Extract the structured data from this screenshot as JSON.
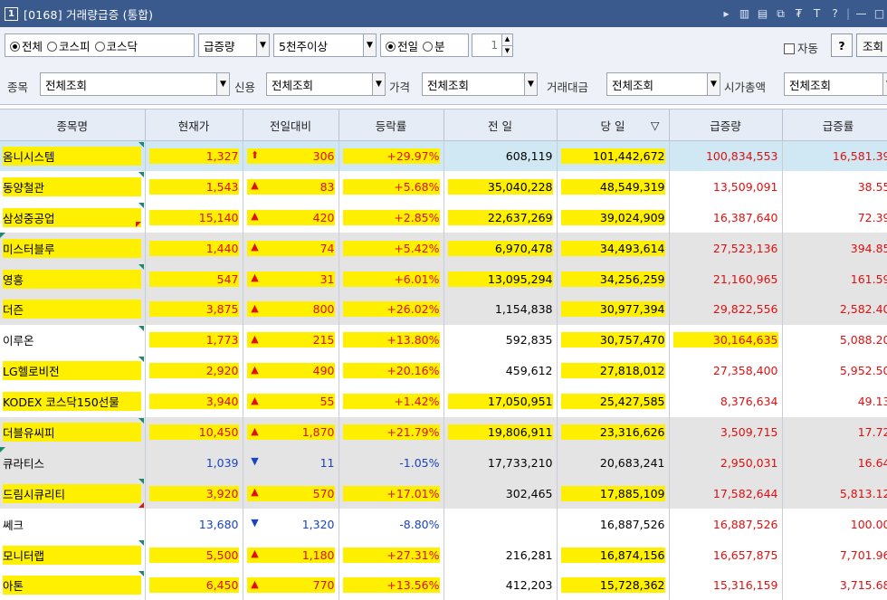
{
  "window": {
    "number": "1",
    "title": "[0168] 거래량급증 (통합)",
    "tools": [
      "▸",
      "▥",
      "▤",
      "⧉",
      "₮",
      "T",
      "?",
      "|",
      "—",
      "□"
    ]
  },
  "toolbar1": {
    "market_options": [
      "전체",
      "코스피",
      "코스닥"
    ],
    "market_selected": "전체",
    "sort_combo": "급증량",
    "volume_combo": "5천주이상",
    "period_options": [
      "전일",
      "분"
    ],
    "period_selected": "전일",
    "minute_value": "1",
    "auto_label": "자동",
    "help_label": "?",
    "query_label": "조회"
  },
  "toolbar2": {
    "stock_label": "종목",
    "stock_value": "전체조회",
    "credit_label": "신용",
    "credit_value": "전체조회",
    "price_label": "가격",
    "price_value": "전체조회",
    "amount_label": "거래대금",
    "amount_value": "전체조회",
    "mcap_label": "시가총액",
    "mcap_value": "전체조회"
  },
  "columns": [
    "종목명",
    "현재가",
    "전일대비",
    "등락률",
    "전 일",
    "당 일",
    "급증량",
    "급증률"
  ],
  "sort_indicator": "▽",
  "rows": [
    {
      "name": "옴니시스템",
      "price": "1,327",
      "sign": "⬆",
      "change": "306",
      "rate": "+29.97%",
      "prev": "608,119",
      "today": "101,442,672",
      "surge": "100,834,553",
      "surge_rate": "16,581.39"
    },
    {
      "name": "동양철관",
      "price": "1,543",
      "sign": "▲",
      "change": "83",
      "rate": "+5.68%",
      "prev": "35,040,228",
      "today": "48,549,319",
      "surge": "13,509,091",
      "surge_rate": "38.55"
    },
    {
      "name": "삼성중공업",
      "price": "15,140",
      "sign": "▲",
      "change": "420",
      "rate": "+2.85%",
      "prev": "22,637,269",
      "today": "39,024,909",
      "surge": "16,387,640",
      "surge_rate": "72.39"
    },
    {
      "name": "미스터블루",
      "price": "1,440",
      "sign": "▲",
      "change": "74",
      "rate": "+5.42%",
      "prev": "6,970,478",
      "today": "34,493,614",
      "surge": "27,523,136",
      "surge_rate": "394.85"
    },
    {
      "name": "영흥",
      "price": "547",
      "sign": "▲",
      "change": "31",
      "rate": "+6.01%",
      "prev": "13,095,294",
      "today": "34,256,259",
      "surge": "21,160,965",
      "surge_rate": "161.59"
    },
    {
      "name": "더즌",
      "price": "3,875",
      "sign": "▲",
      "change": "800",
      "rate": "+26.02%",
      "prev": "1,154,838",
      "today": "30,977,394",
      "surge": "29,822,556",
      "surge_rate": "2,582.40"
    },
    {
      "name": "이루온",
      "price": "1,773",
      "sign": "▲",
      "change": "215",
      "rate": "+13.80%",
      "prev": "592,835",
      "today": "30,757,470",
      "surge": "30,164,635",
      "surge_rate": "5,088.20"
    },
    {
      "name": "LG헬로비전",
      "price": "2,920",
      "sign": "▲",
      "change": "490",
      "rate": "+20.16%",
      "prev": "459,612",
      "today": "27,818,012",
      "surge": "27,358,400",
      "surge_rate": "5,952.50"
    },
    {
      "name": "KODEX 코스닥150선물",
      "price": "3,940",
      "sign": "▲",
      "change": "55",
      "rate": "+1.42%",
      "prev": "17,050,951",
      "today": "25,427,585",
      "surge": "8,376,634",
      "surge_rate": "49.13"
    },
    {
      "name": "더블유씨피",
      "price": "10,450",
      "sign": "▲",
      "change": "1,870",
      "rate": "+21.79%",
      "prev": "19,806,911",
      "today": "23,316,626",
      "surge": "3,509,715",
      "surge_rate": "17.72"
    },
    {
      "name": "큐라티스",
      "price": "1,039",
      "sign": "▼",
      "change": "11",
      "rate": "-1.05%",
      "prev": "17,733,210",
      "today": "20,683,241",
      "surge": "2,950,031",
      "surge_rate": "16.64"
    },
    {
      "name": "드림시큐리티",
      "price": "3,920",
      "sign": "▲",
      "change": "570",
      "rate": "+17.01%",
      "prev": "302,465",
      "today": "17,885,109",
      "surge": "17,582,644",
      "surge_rate": "5,813.12"
    },
    {
      "name": "쎄크",
      "price": "13,680",
      "sign": "▼",
      "change": "1,320",
      "rate": "-8.80%",
      "prev": "",
      "today": "16,887,526",
      "surge": "16,887,526",
      "surge_rate": "100.00"
    },
    {
      "name": "모니터랩",
      "price": "5,500",
      "sign": "▲",
      "change": "1,180",
      "rate": "+27.31%",
      "prev": "216,281",
      "today": "16,874,156",
      "surge": "16,657,875",
      "surge_rate": "7,701.96"
    },
    {
      "name": "아톤",
      "price": "6,450",
      "sign": "▲",
      "change": "770",
      "rate": "+13.56%",
      "prev": "412,203",
      "today": "15,728,362",
      "surge": "15,316,159",
      "surge_rate": "3,715.68"
    }
  ],
  "colors": {
    "titlebar": "#3a5a8e",
    "highlight": "#ffef00",
    "up": "#e01010",
    "down": "#1844c0",
    "selected_row": "#cfe8f3",
    "gray_row": "#e4e4e4"
  }
}
